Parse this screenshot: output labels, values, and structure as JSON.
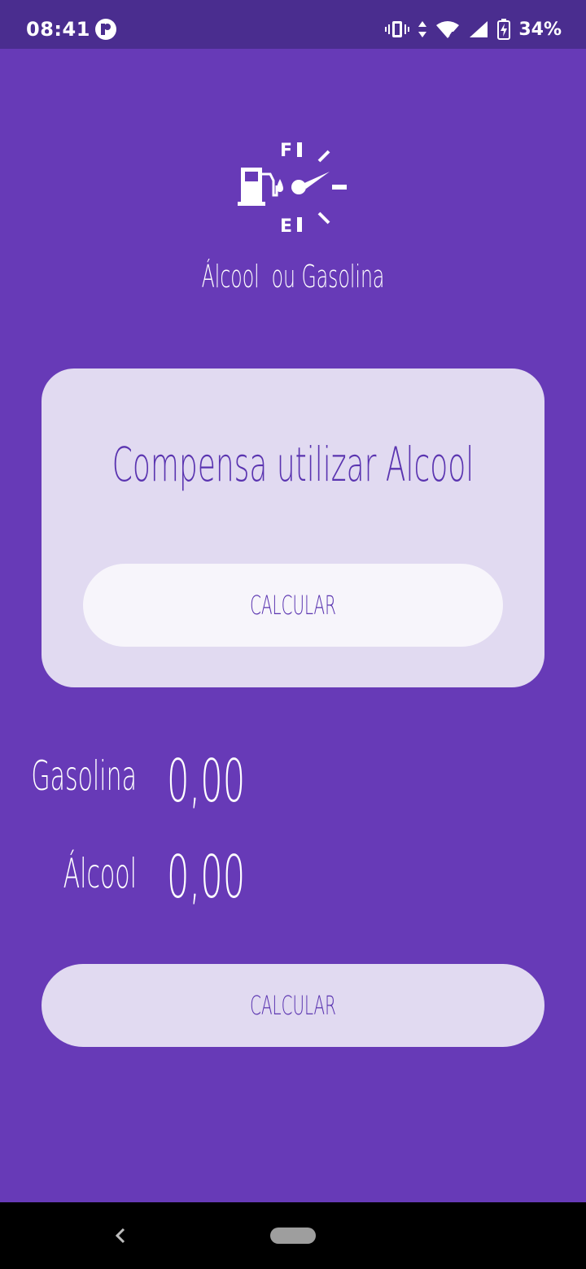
{
  "status_bar": {
    "time": "08:41",
    "battery": "34%",
    "icons": [
      "app-notification-icon",
      "vibrate-icon",
      "data-arrows-icon",
      "wifi-icon",
      "cell-signal-icon",
      "battery-charging-icon"
    ]
  },
  "header": {
    "logo_icon": "fuel-gauge-icon",
    "gauge_full": "F",
    "gauge_empty": "E",
    "title": "Álcool  ou Gasolina"
  },
  "card": {
    "result": "Compensa utilizar Alcool",
    "button_label": "CALCULAR"
  },
  "prices": {
    "gasolina_label": "Gasolina",
    "gasolina_value": "0,00",
    "alcool_label": "Álcool",
    "alcool_value": "0,00"
  },
  "main_button": {
    "label": "CALCULAR"
  },
  "nav": {
    "icons": [
      "back-icon",
      "home-pill-icon"
    ]
  },
  "colors": {
    "background": "#673ab7",
    "status_bar": "#4a2d8f",
    "card": "#e1daf1",
    "accent_text": "#5a34b0"
  }
}
